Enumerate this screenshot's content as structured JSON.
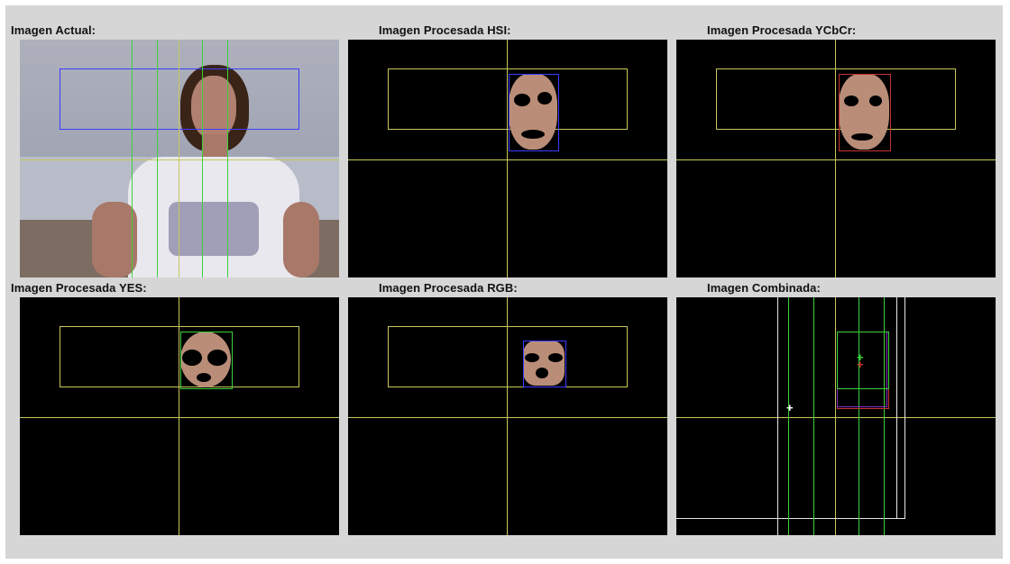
{
  "panels": {
    "actual": {
      "label": "Imagen Actual:"
    },
    "hsi": {
      "label": "Imagen Procesada HSI:"
    },
    "ycbcr": {
      "label": "Imagen Procesada YCbCr:"
    },
    "yes": {
      "label": "Imagen Procesada YES:"
    },
    "rgb": {
      "label": "Imagen Procesada RGB:"
    },
    "combinada": {
      "label": "Imagen Combinada:"
    }
  },
  "colors": {
    "window_bg": "#d6d6d6",
    "guide_line": "#c8c85a",
    "green_line": "#3cd23c",
    "blue_box": "#3c3cff",
    "red_box": "#c83232",
    "white_line": "#e6e6e6",
    "skin": "#b98d78"
  },
  "icons": {
    "centroid_marker": "plus-icon"
  }
}
